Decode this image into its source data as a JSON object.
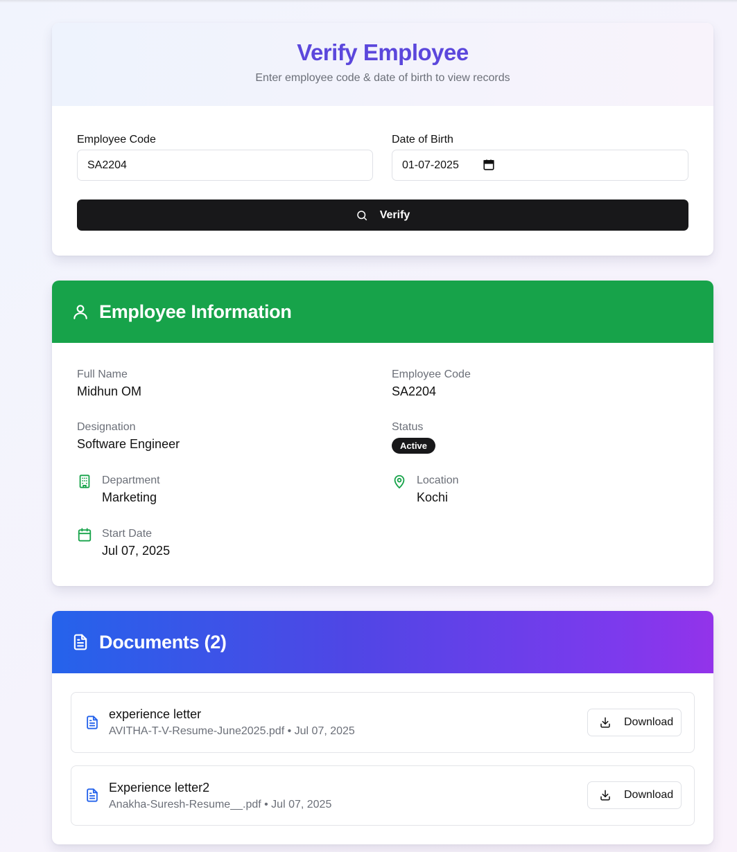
{
  "verify": {
    "title": "Verify Employee",
    "subtitle": "Enter employee code & date of birth to view records",
    "code_label": "Employee Code",
    "code_value": "SA2204",
    "dob_label": "Date of Birth",
    "dob_value": "01-07-2025",
    "button_label": "Verify"
  },
  "info": {
    "title": "Employee Information",
    "full_name_label": "Full Name",
    "full_name": "Midhun OM",
    "code_label": "Employee Code",
    "code": "SA2204",
    "designation_label": "Designation",
    "designation": "Software Engineer",
    "status_label": "Status",
    "status": "Active",
    "department_label": "Department",
    "department": "Marketing",
    "location_label": "Location",
    "location": "Kochi",
    "start_date_label": "Start Date",
    "start_date": "Jul 07, 2025"
  },
  "documents": {
    "title": "Documents (2)",
    "items": [
      {
        "name": "experience letter",
        "meta": "AVITHA-T-V-Resume-June2025.pdf • Jul 07, 2025",
        "action": "Download"
      },
      {
        "name": "Experience letter2",
        "meta": "Anakha-Suresh-Resume__.pdf • Jul 07, 2025",
        "action": "Download"
      }
    ]
  },
  "colors": {
    "accent_title": "#5b47dc",
    "info_header": "#17a34a",
    "docs_gradient_start": "#2563eb",
    "docs_gradient_end": "#9333ea",
    "button_dark": "#18181a"
  },
  "icons": {
    "search": "search-icon",
    "calendar": "calendar-icon",
    "user": "user-icon",
    "building": "building-icon",
    "map_pin": "map-pin-icon",
    "file": "file-text-icon",
    "download": "download-icon"
  }
}
